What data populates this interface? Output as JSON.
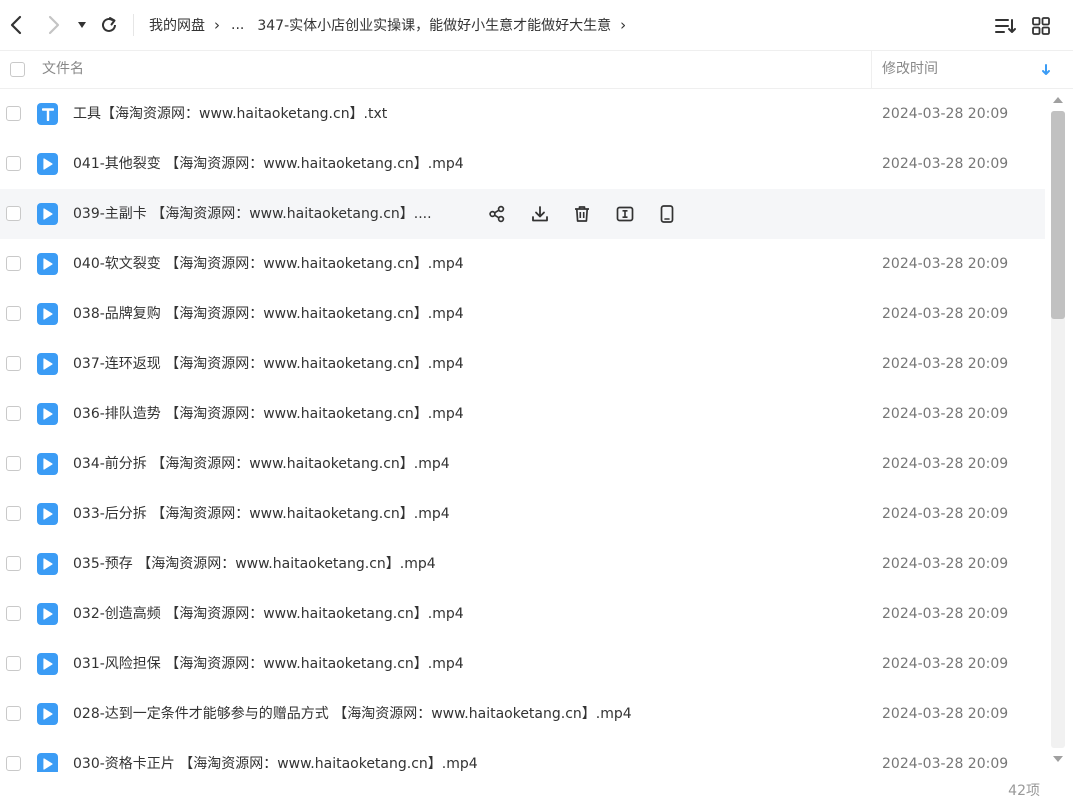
{
  "toolbar": {
    "breadcrumb": [
      "我的网盘",
      "...",
      "347-实体小店创业实操课，能做好小生意才能做好大生意"
    ]
  },
  "header": {
    "name_label": "文件名",
    "time_label": "修改时间"
  },
  "files": [
    {
      "name": "工具【海淘资源网：www.haitaoketang.cn】.txt",
      "time": "2024-03-28 20:09",
      "icon": "text-file-icon",
      "letter": "T"
    },
    {
      "name": "041-其他裂变 【海淘资源网：www.haitaoketang.cn】.mp4",
      "time": "2024-03-28 20:09",
      "icon": "video-file-icon"
    },
    {
      "name": "039-主副卡 【海淘资源网：www.haitaoketang.cn】....",
      "time": "",
      "icon": "video-file-icon",
      "hovered": true
    },
    {
      "name": "040-软文裂变 【海淘资源网：www.haitaoketang.cn】.mp4",
      "time": "2024-03-28 20:09",
      "icon": "video-file-icon"
    },
    {
      "name": "038-品牌复购 【海淘资源网：www.haitaoketang.cn】.mp4",
      "time": "2024-03-28 20:09",
      "icon": "video-file-icon"
    },
    {
      "name": "037-连环返现 【海淘资源网：www.haitaoketang.cn】.mp4",
      "time": "2024-03-28 20:09",
      "icon": "video-file-icon"
    },
    {
      "name": "036-排队造势 【海淘资源网：www.haitaoketang.cn】.mp4",
      "time": "2024-03-28 20:09",
      "icon": "video-file-icon"
    },
    {
      "name": "034-前分拆 【海淘资源网：www.haitaoketang.cn】.mp4",
      "time": "2024-03-28 20:09",
      "icon": "video-file-icon"
    },
    {
      "name": "033-后分拆 【海淘资源网：www.haitaoketang.cn】.mp4",
      "time": "2024-03-28 20:09",
      "icon": "video-file-icon"
    },
    {
      "name": "035-预存 【海淘资源网：www.haitaoketang.cn】.mp4",
      "time": "2024-03-28 20:09",
      "icon": "video-file-icon"
    },
    {
      "name": "032-创造高频 【海淘资源网：www.haitaoketang.cn】.mp4",
      "time": "2024-03-28 20:09",
      "icon": "video-file-icon"
    },
    {
      "name": "031-风险担保 【海淘资源网：www.haitaoketang.cn】.mp4",
      "time": "2024-03-28 20:09",
      "icon": "video-file-icon"
    },
    {
      "name": "028-达到一定条件才能够参与的赠品方式 【海淘资源网：www.haitaoketang.cn】.mp4",
      "time": "2024-03-28 20:09",
      "icon": "video-file-icon"
    },
    {
      "name": "030-资格卡正片 【海淘资源网：www.haitaoketang.cn】.mp4",
      "time": "2024-03-28 20:09",
      "icon": "video-file-icon"
    }
  ],
  "hover_actions": [
    "share-icon",
    "download-icon",
    "delete-icon",
    "rename-icon",
    "mobile-icon"
  ],
  "footer": {
    "count": "42项"
  },
  "colors": {
    "accent": "#3b9cf5",
    "hover_row": "#f5f6f8"
  }
}
